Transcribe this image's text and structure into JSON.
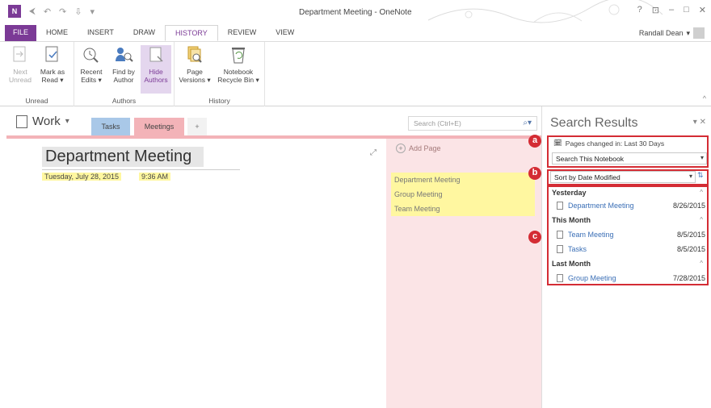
{
  "window": {
    "title": "Department Meeting - OneNote",
    "controls": [
      "?",
      "⊡",
      "–",
      "□",
      "✕"
    ]
  },
  "qat": {
    "logo": "N",
    "back": "⮜",
    "undo": "↶",
    "redo": "↷",
    "touch": "⇩",
    "more": "▾"
  },
  "ribbon_tabs": [
    "FILE",
    "HOME",
    "INSERT",
    "DRAW",
    "HISTORY",
    "REVIEW",
    "VIEW"
  ],
  "active_tab": "HISTORY",
  "user": "Randall Dean",
  "ribbon": {
    "groups": [
      {
        "label": "Unread",
        "buttons": [
          {
            "label1": "Next",
            "label2": "Unread",
            "icon": "next-unread-icon",
            "disabled": true
          },
          {
            "label1": "Mark as",
            "label2": "Read ▾",
            "icon": "mark-read-icon"
          }
        ]
      },
      {
        "label": "Authors",
        "buttons": [
          {
            "label1": "Recent",
            "label2": "Edits ▾",
            "icon": "recent-edits-icon"
          },
          {
            "label1": "Find by",
            "label2": "Author",
            "icon": "find-author-icon"
          },
          {
            "label1": "Hide",
            "label2": "Authors",
            "icon": "hide-authors-icon",
            "highlighted": true
          }
        ]
      },
      {
        "label": "History",
        "buttons": [
          {
            "label1": "Page",
            "label2": "Versions ▾",
            "icon": "page-versions-icon"
          },
          {
            "label1": "Notebook",
            "label2": "Recycle Bin ▾",
            "icon": "recycle-bin-icon"
          }
        ]
      }
    ]
  },
  "notebook": {
    "name": "Work",
    "sections": [
      "Tasks",
      "Meetings"
    ],
    "add_section": "+",
    "active_section": "Meetings"
  },
  "search": {
    "placeholder": "Search (Ctrl+E)",
    "icon": "search-icon"
  },
  "page": {
    "title": "Department Meeting",
    "date": "Tuesday, July 28, 2015",
    "time": "9:36 AM"
  },
  "page_list": {
    "add_page": "Add Page",
    "pages": [
      "Department Meeting",
      "Group Meeting",
      "Team Meeting"
    ]
  },
  "search_results": {
    "title": "Search Results",
    "scope_label": "Pages changed in: Last 30 Days",
    "scope_dropdown": "Search This Notebook",
    "sort_dropdown": "Sort by Date Modified",
    "groups": [
      {
        "name": "Yesterday",
        "items": [
          {
            "title": "Department Meeting",
            "date": "8/26/2015"
          }
        ]
      },
      {
        "name": "This Month",
        "items": [
          {
            "title": "Team Meeting",
            "date": "8/5/2015"
          },
          {
            "title": "Tasks",
            "date": "8/5/2015"
          }
        ]
      },
      {
        "name": "Last Month",
        "items": [
          {
            "title": "Group Meeting",
            "date": "7/28/2015"
          }
        ]
      }
    ]
  },
  "callouts": [
    "a",
    "b",
    "c"
  ],
  "colors": {
    "accent": "#7b3a96",
    "callout": "#d42c34",
    "tasks_tab": "#a9c8e8",
    "meetings_tab": "#f3b3b8",
    "page_list_bg": "#fbe4e6",
    "highlight": "#fff7a0"
  }
}
